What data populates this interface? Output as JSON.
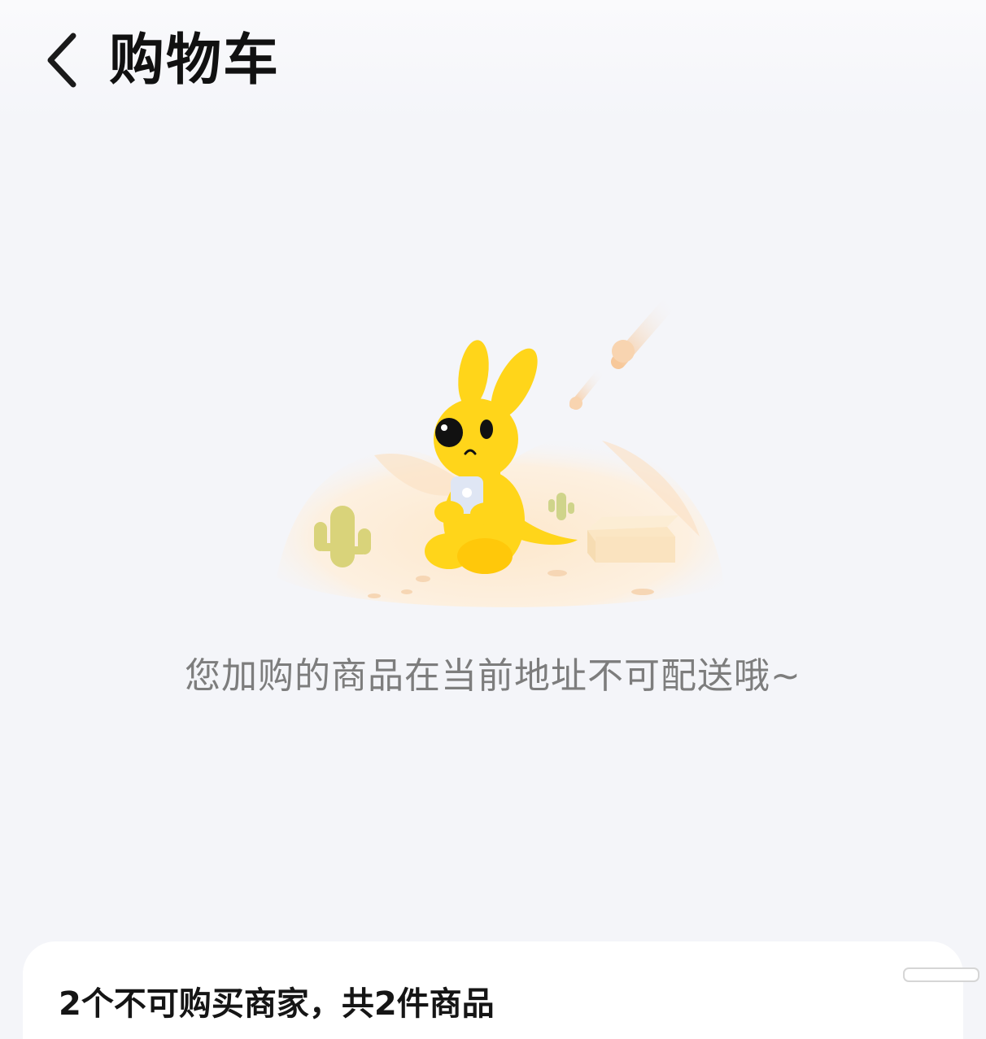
{
  "header": {
    "back_icon": "chevron-left-icon",
    "title": "购物车"
  },
  "empty_state": {
    "illustration": "sad-yellow-kangaroo-desert-illustration",
    "message": "您加购的商品在当前地址不可配送哦~"
  },
  "bottom_card": {
    "summary": "2个不可购买商家，共2件商品"
  },
  "colors": {
    "background": "#f4f5f9",
    "mascot_yellow": "#ffd51a",
    "text_secondary": "#7d7d7d"
  }
}
